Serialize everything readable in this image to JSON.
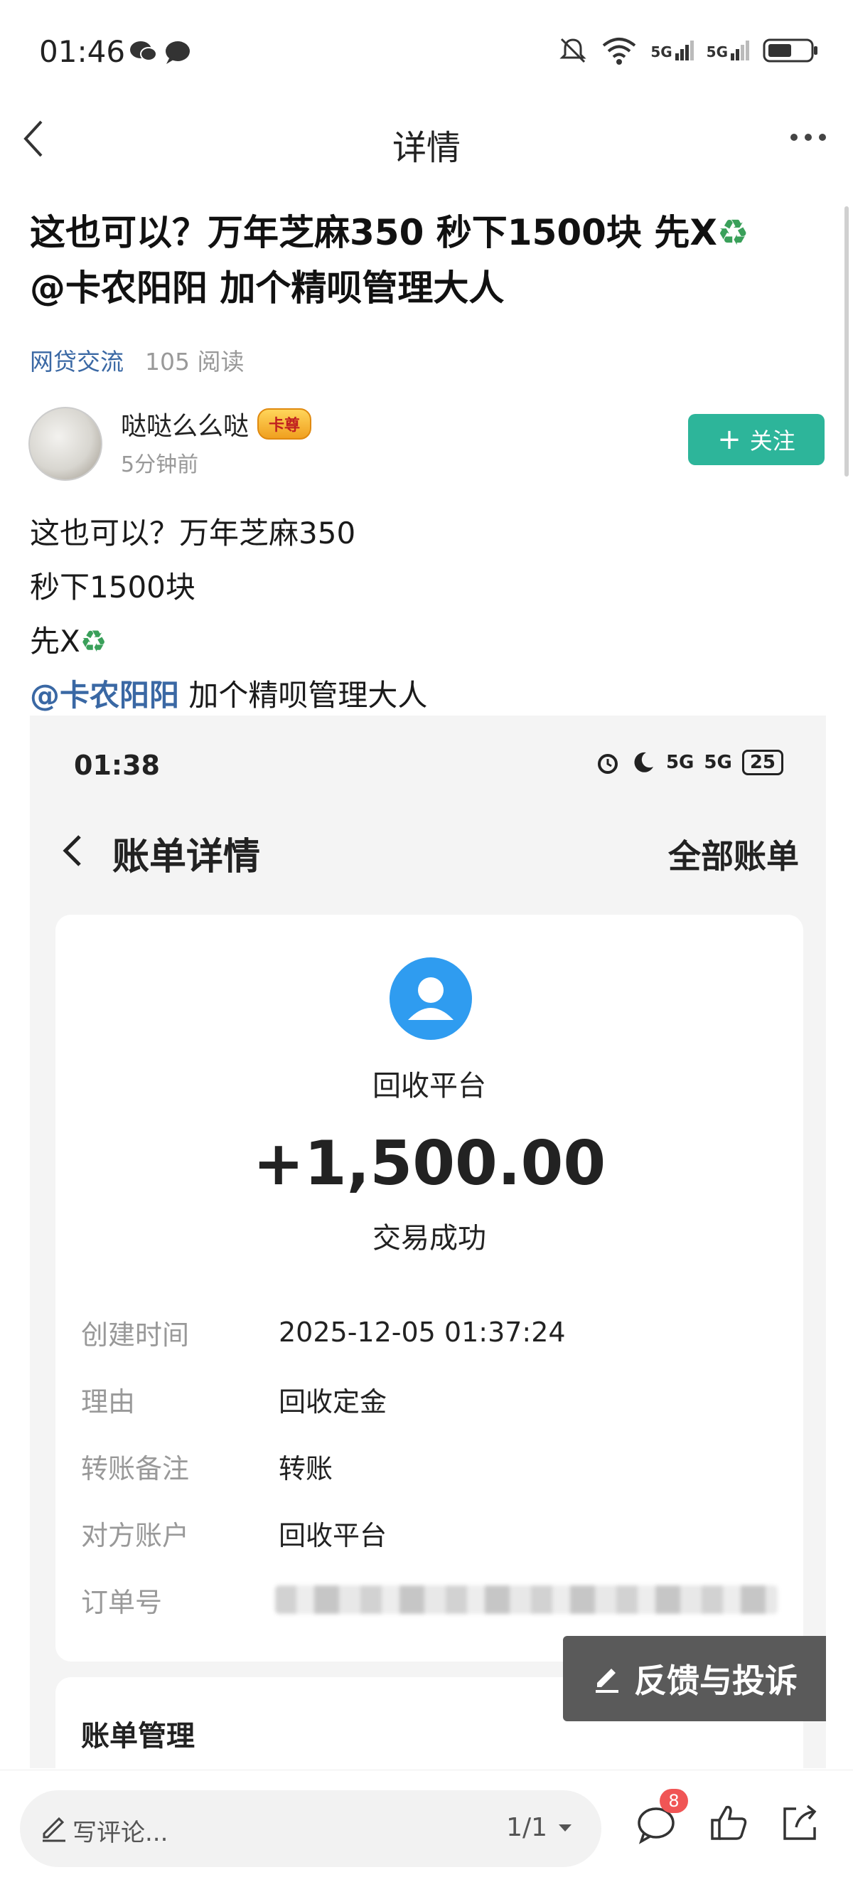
{
  "status_bar": {
    "time": "01:46",
    "network_1": "5G",
    "network_2": "5G"
  },
  "nav": {
    "title": "详情"
  },
  "post": {
    "title_line1": "这也可以？万年芝麻350 秒下1500块 先X",
    "title_line2": "@卡农阳阳 加个精呗管理大人",
    "recycle_symbol": "♻",
    "forum": "网贷交流",
    "read_count": "105 阅读",
    "author": {
      "name": "哒哒么么哒",
      "badge": "卡尊",
      "time": "5分钟前"
    },
    "follow_label": "关注",
    "body": {
      "line1": "这也可以？万年芝麻350",
      "line2": "秒下1500块",
      "line3": "先X",
      "mention": "@卡农阳阳",
      "line4_rest": " 加个精呗管理大人"
    }
  },
  "embedded_screenshot": {
    "time": "01:38",
    "network_1": "5G",
    "network_2": "5G",
    "battery": "25",
    "title": "账单详情",
    "all_bills": "全部账单",
    "payee": "回收平台",
    "amount": "+1,500.00",
    "status": "交易成功",
    "rows": [
      {
        "label": "创建时间",
        "value": "2025-12-05 01:37:24"
      },
      {
        "label": "理由",
        "value": "回收定金"
      },
      {
        "label": "转账备注",
        "value": "转账"
      },
      {
        "label": "对方账户",
        "value": "回收平台"
      },
      {
        "label": "订单号",
        "value": ""
      }
    ],
    "manage_label": "账单管理",
    "feedback_label": "反馈与投诉"
  },
  "bottom_bar": {
    "comment_placeholder": "写评论...",
    "page_indicator": "1/1",
    "comment_count": "8"
  }
}
